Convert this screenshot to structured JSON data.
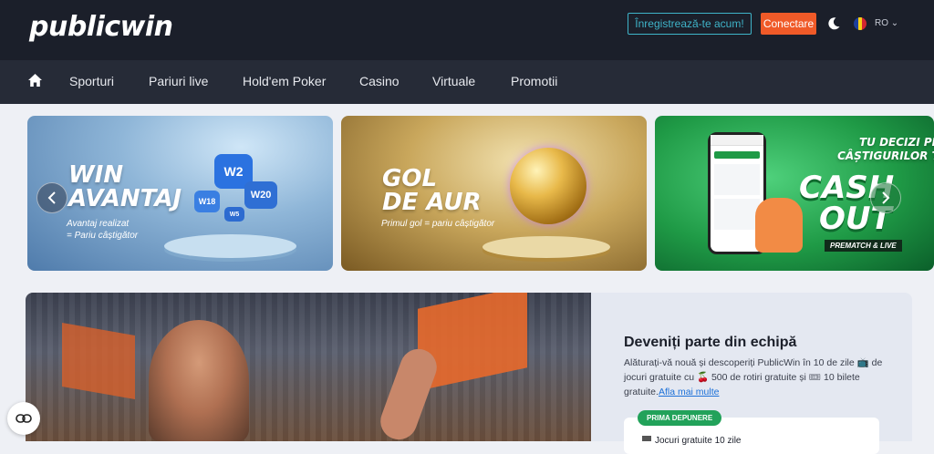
{
  "header": {
    "logo_text": "publicwin",
    "register_label": "Înregistrează-te acum!",
    "login_label": "Conectare",
    "language": "RO",
    "accent_color": "#f05a28",
    "teal_color": "#3fb4c9"
  },
  "nav": {
    "home_icon": "home-icon",
    "items": [
      {
        "label": "Sporturi"
      },
      {
        "label": "Pariuri live"
      },
      {
        "label": "Hold'em Poker"
      },
      {
        "label": "Casino"
      },
      {
        "label": "Virtuale"
      },
      {
        "label": "Promotii"
      }
    ]
  },
  "carousel": {
    "banners": [
      {
        "title_line1": "WIN",
        "title_line2": "AVANTAJ",
        "subtitle_line1": "Avantaj realizat",
        "subtitle_line2": "= Pariu câștigător",
        "chips": [
          "W2",
          "W20",
          "W18",
          "W5"
        ]
      },
      {
        "title_line1": "GOL",
        "title_line2": "DE AUR",
        "subtitle_line1": "Primul gol = pariu câștigător"
      },
      {
        "title_line1": "TU DECIZI PLATA",
        "title_line2": "CÂȘTIGURILOR TALE",
        "big_line1": "CASH",
        "big_line2": "OUT",
        "tag": "PREMATCH & LIVE"
      }
    ]
  },
  "promo": {
    "title": "Deveniți parte din echipă",
    "text_part1": "Alăturați-vă nouă și descoperiți PublicWin în 10 de zile",
    "text_part2": "de jocuri gratuite cu",
    "text_part3": "500 de rotiri gratuite și",
    "text_part4": "10 bilete gratuite.",
    "link_label": "Afla mai multe",
    "badge_label": "PRIMA DEPUNERE",
    "card_text": "Jocuri gratuite 10 zile"
  }
}
